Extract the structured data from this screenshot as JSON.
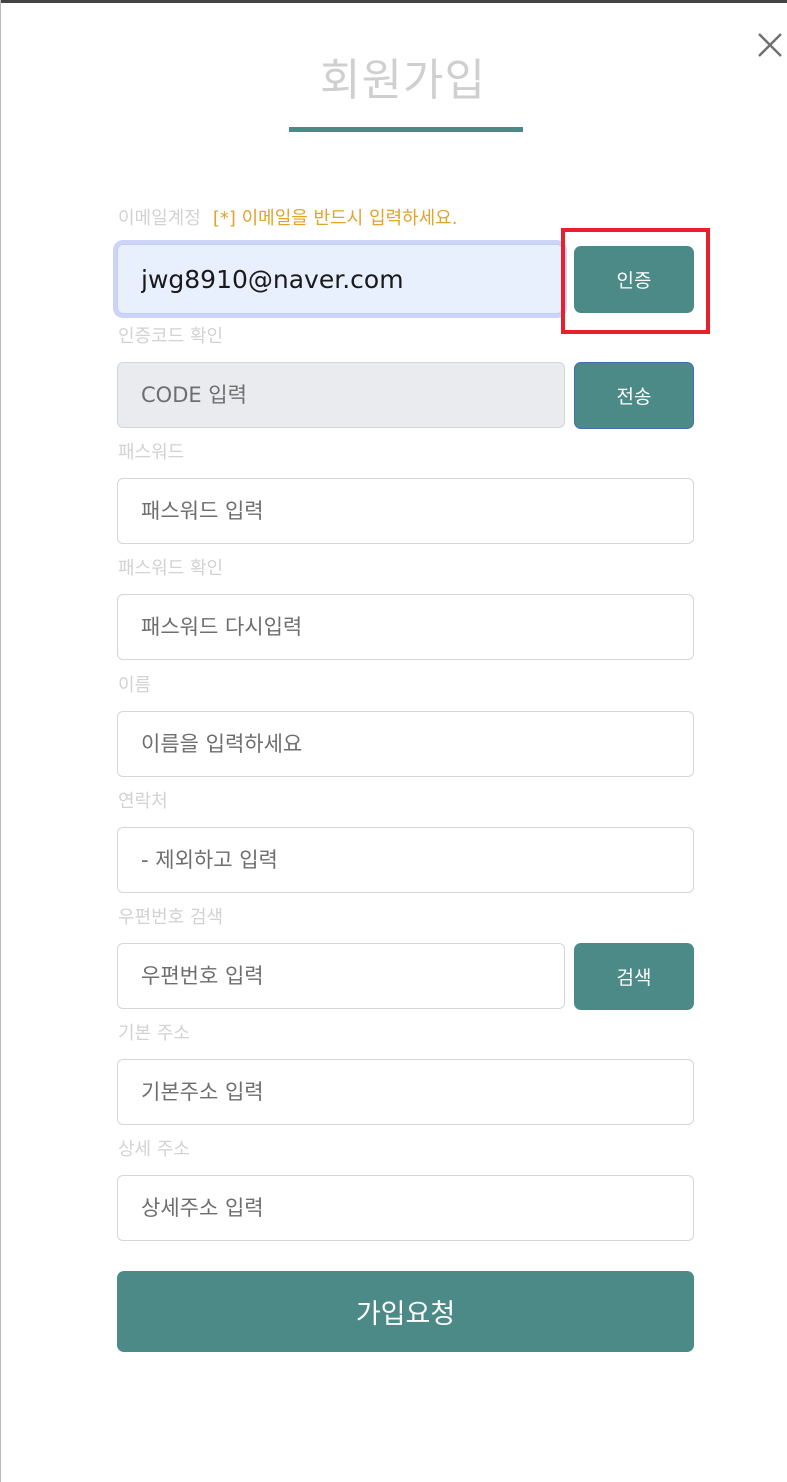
{
  "title": "회원가입",
  "email": {
    "label": "이메일계정",
    "hint": "[*] 이메일을 반드시 입력하세요.",
    "value": "jwg8910@naver.com",
    "verify_button": "인증"
  },
  "code": {
    "label": "인증코드 확인",
    "placeholder": "CODE 입력",
    "send_button": "전송"
  },
  "password": {
    "label": "패스워드",
    "placeholder": "패스워드 입력"
  },
  "password_confirm": {
    "label": "패스워드 확인",
    "placeholder": "패스워드 다시입력"
  },
  "name": {
    "label": "이름",
    "placeholder": "이름을 입력하세요"
  },
  "phone": {
    "label": "연락처",
    "placeholder": "- 제외하고 입력"
  },
  "zipcode": {
    "label": "우편번호 검색",
    "placeholder": "우편번호 입력",
    "search_button": "검색"
  },
  "address": {
    "label": "기본 주소",
    "placeholder": "기본주소 입력"
  },
  "address_detail": {
    "label": "상세 주소",
    "placeholder": "상세주소 입력"
  },
  "submit_label": "가입요청",
  "colors": {
    "accent": "#4c8a88",
    "hint": "#e0a32e",
    "highlight": "#e8202b",
    "label": "#d2d2d2"
  }
}
